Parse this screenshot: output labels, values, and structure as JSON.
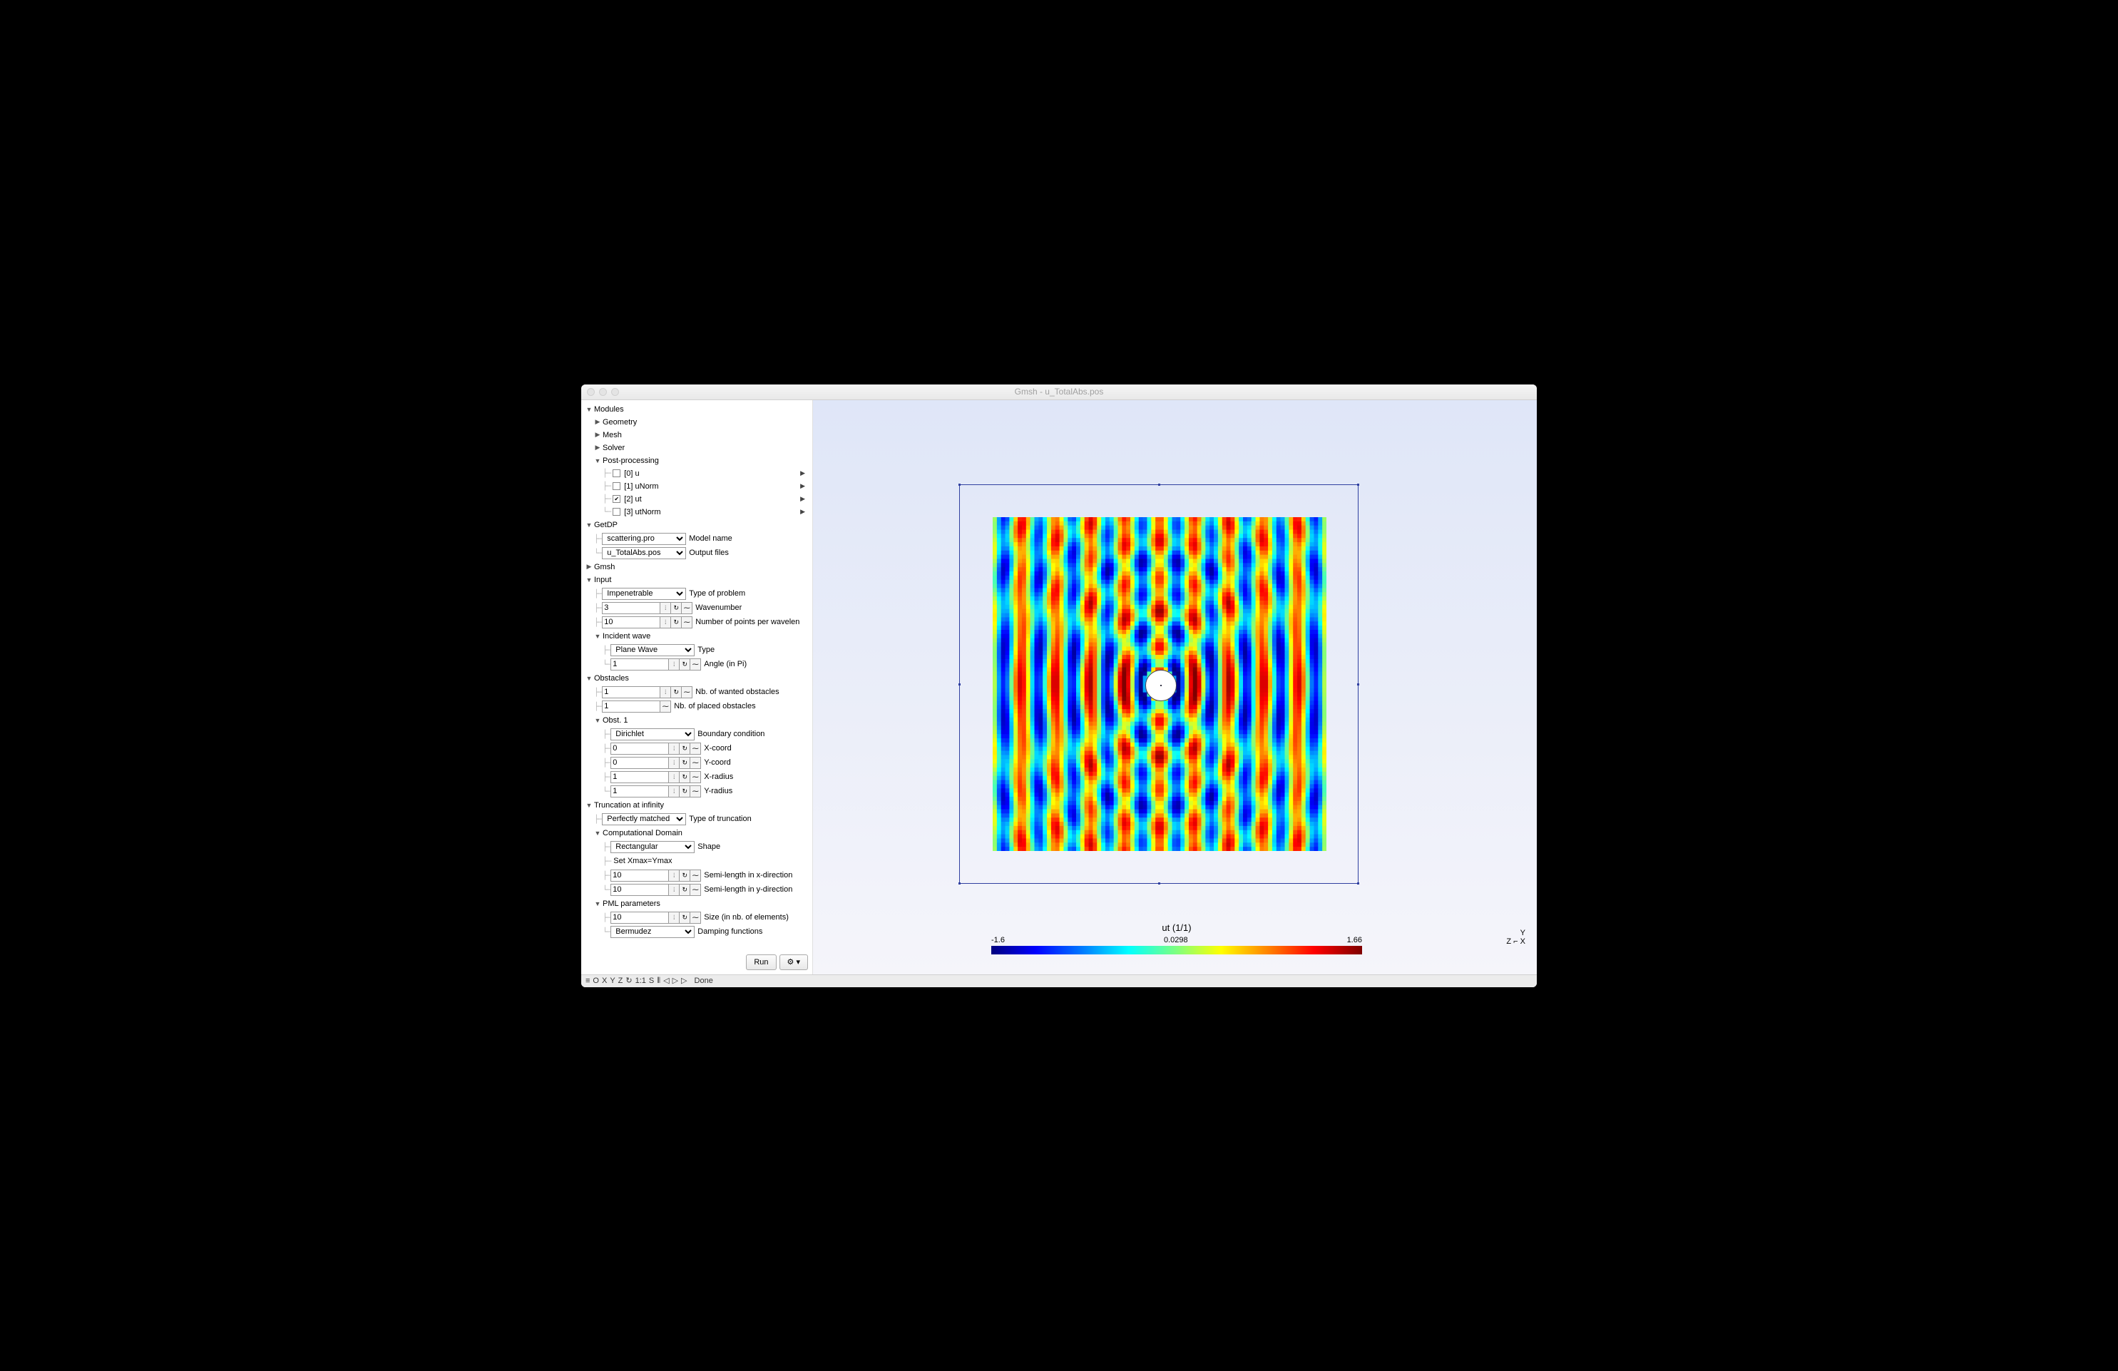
{
  "window": {
    "title": "Gmsh - u_TotalAbs.pos"
  },
  "tree": {
    "modules": "Modules",
    "geometry": "Geometry",
    "mesh": "Mesh",
    "solver": "Solver",
    "postproc": "Post-processing",
    "views": [
      {
        "label": "[0] u",
        "checked": false
      },
      {
        "label": "[1] uNorm",
        "checked": false
      },
      {
        "label": "[2] ut",
        "checked": true
      },
      {
        "label": "[3] utNorm",
        "checked": false
      }
    ],
    "getdp": "GetDP",
    "getdp_model": {
      "value": "scattering.pro",
      "label": "Model name"
    },
    "getdp_output": {
      "value": "u_TotalAbs.pos",
      "label": "Output files"
    },
    "gmsh": "Gmsh",
    "input": "Input",
    "input_type": {
      "value": "Impenetrable",
      "label": "Type of problem"
    },
    "input_wavenum": {
      "value": "3",
      "label": "Wavenumber"
    },
    "input_npts": {
      "value": "10",
      "label": "Number of points per wavelen"
    },
    "incident": "Incident wave",
    "incident_type": {
      "value": "Plane Wave",
      "label": "Type"
    },
    "incident_angle": {
      "value": "1",
      "label": "Angle (in Pi)"
    },
    "obstacles": "Obstacles",
    "obst_wanted": {
      "value": "1",
      "label": "Nb. of wanted obstacles"
    },
    "obst_placed": {
      "value": "1",
      "label": "Nb. of placed obstacles"
    },
    "obst1": "Obst. 1",
    "obst1_bc": {
      "value": "Dirichlet",
      "label": "Boundary condition"
    },
    "obst1_x": {
      "value": "0",
      "label": "X-coord"
    },
    "obst1_y": {
      "value": "0",
      "label": "Y-coord"
    },
    "obst1_xr": {
      "value": "1",
      "label": "X-radius"
    },
    "obst1_yr": {
      "value": "1",
      "label": "Y-radius"
    },
    "truncation": "Truncation at infinity",
    "trunc_type": {
      "value": "Perfectly matched laye",
      "label": "Type of truncation"
    },
    "compdom": "Computational Domain",
    "compdom_shape": {
      "value": "Rectangular",
      "label": "Shape"
    },
    "compdom_setxy": {
      "label": "Set Xmax=Ymax",
      "checked": false
    },
    "compdom_sx": {
      "value": "10",
      "label": "Semi-length in x-direction"
    },
    "compdom_sy": {
      "value": "10",
      "label": "Semi-length in y-direction"
    },
    "pml": "PML parameters",
    "pml_size": {
      "value": "10",
      "label": "Size (in nb. of elements)"
    },
    "pml_damp": {
      "value": "Bermudez",
      "label": "Damping functions"
    }
  },
  "buttons": {
    "run": "Run",
    "gear": "⚙",
    "filter": "▾"
  },
  "legend": {
    "title": "ut (1/1)",
    "min": "-1.6",
    "mid": "0.0298",
    "max": "1.66"
  },
  "axes": {
    "x": "X",
    "y": "Y",
    "z": "Z"
  },
  "status": {
    "items": [
      "≡",
      "O",
      "X",
      "Y",
      "Z",
      "↻",
      "1:1",
      "S",
      "⦀",
      "◁",
      "▷",
      "▷"
    ],
    "msg": "Done"
  },
  "chart_data": {
    "type": "heatmap",
    "title": "ut (1/1)",
    "colormap": "jet",
    "value_range": [
      -1.6,
      1.66
    ],
    "domain": {
      "x": [
        -10,
        10
      ],
      "y": [
        -10,
        10
      ]
    },
    "pml_box": {
      "x": [
        -12,
        12
      ],
      "y": [
        -12,
        12
      ]
    },
    "obstacle": {
      "cx": 0,
      "cy": 0,
      "rx": 1,
      "ry": 1,
      "bc": "Dirichlet"
    },
    "field": "total field |u_t| for plane-wave scattering, wavenumber k=3, incident angle = 1·π, ~10 vertical interference fringes across domain with shadow/diffraction pattern around circular obstacle at origin"
  }
}
